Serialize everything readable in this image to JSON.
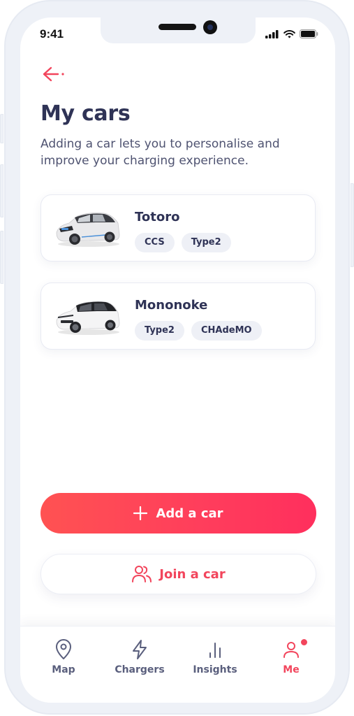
{
  "status_bar": {
    "time": "9:41",
    "icons": [
      "signal-icon",
      "wifi-icon",
      "battery-icon"
    ]
  },
  "header": {
    "back_icon": "arrow-left-icon",
    "title": "My cars",
    "subtitle": "Adding a car lets you to personalise and improve your charging experience."
  },
  "cars": [
    {
      "name": "Totoro",
      "image": "car-bmw-i3-image",
      "connectors": [
        "CCS",
        "Type2"
      ]
    },
    {
      "name": "Mononoke",
      "image": "car-vw-id3-image",
      "connectors": [
        "Type2",
        "CHAdeMO"
      ]
    }
  ],
  "actions": {
    "add_car": {
      "label": "Add a car",
      "icon": "plus-icon"
    },
    "join_car": {
      "label": "Join a car",
      "icon": "users-icon"
    }
  },
  "tabbar": {
    "tabs": [
      {
        "label": "Map",
        "icon": "map-pin-icon",
        "active": false
      },
      {
        "label": "Chargers",
        "icon": "lightning-icon",
        "active": false
      },
      {
        "label": "Insights",
        "icon": "bar-chart-icon",
        "active": false
      },
      {
        "label": "Me",
        "icon": "user-icon",
        "active": true,
        "notification_dot": true
      }
    ]
  },
  "colors": {
    "accent": "#f2455c",
    "gradient_start": "#ff5252",
    "gradient_end": "#ff2f5d",
    "text_primary": "#2f3356",
    "text_secondary": "#4f5371",
    "tab_inactive": "#5a5f7d",
    "chip_bg": "#eef0f6"
  }
}
